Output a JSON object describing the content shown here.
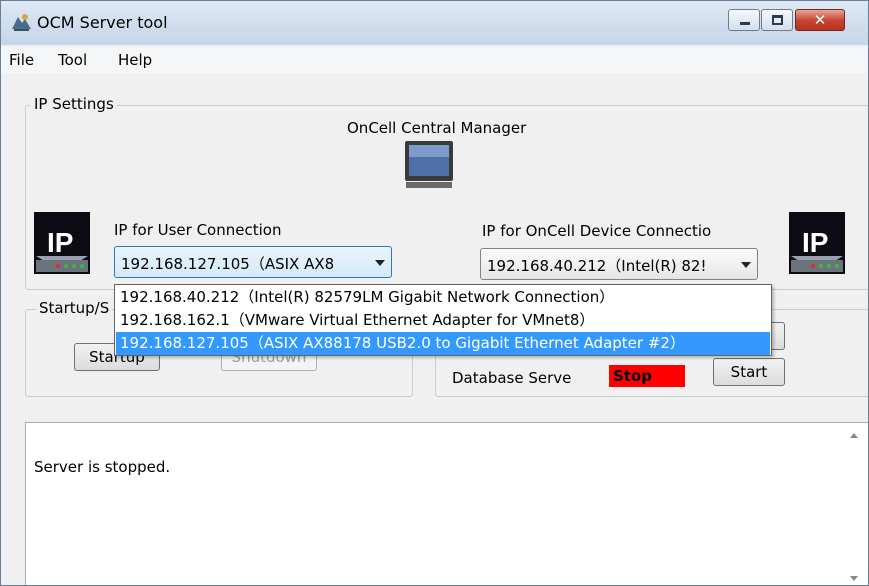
{
  "window": {
    "title": "OCM Server tool"
  },
  "menu": {
    "items": [
      "File",
      "Tool",
      "Help"
    ]
  },
  "ip_settings": {
    "group_label": "IP Settings",
    "central_manager_label": "OnCell Central Manager",
    "user_connection": {
      "label": "IP for User Connection",
      "value": "192.168.127.105（ASIX AX8"
    },
    "device_connection": {
      "label": "IP for OnCell Device Connectio",
      "value": "192.168.40.212（Intel(R) 82!"
    },
    "dropdown_options": [
      "192.168.40.212（Intel(R) 82579LM Gigabit Network Connection）",
      "192.168.162.1（VMware Virtual Ethernet Adapter for VMnet8）",
      "192.168.127.105（ASIX AX88178 USB2.0 to Gigabit Ethernet Adapter #2）"
    ],
    "icons": {
      "left": "ip-network-icon",
      "center": "monitor-icon",
      "right": "ip-network-icon"
    }
  },
  "startup": {
    "group_label": "Startup/S",
    "startup_button": "Startup",
    "shutdown_button": "Shutdown"
  },
  "services": {
    "database_label": "Database Serve",
    "database_status": "Stop",
    "database_start_button": "Start"
  },
  "log": {
    "message": "Server is stopped."
  },
  "colors": {
    "status_stop": "#ff0000",
    "selection": "#3399ff",
    "close_button": "#c7422f"
  }
}
